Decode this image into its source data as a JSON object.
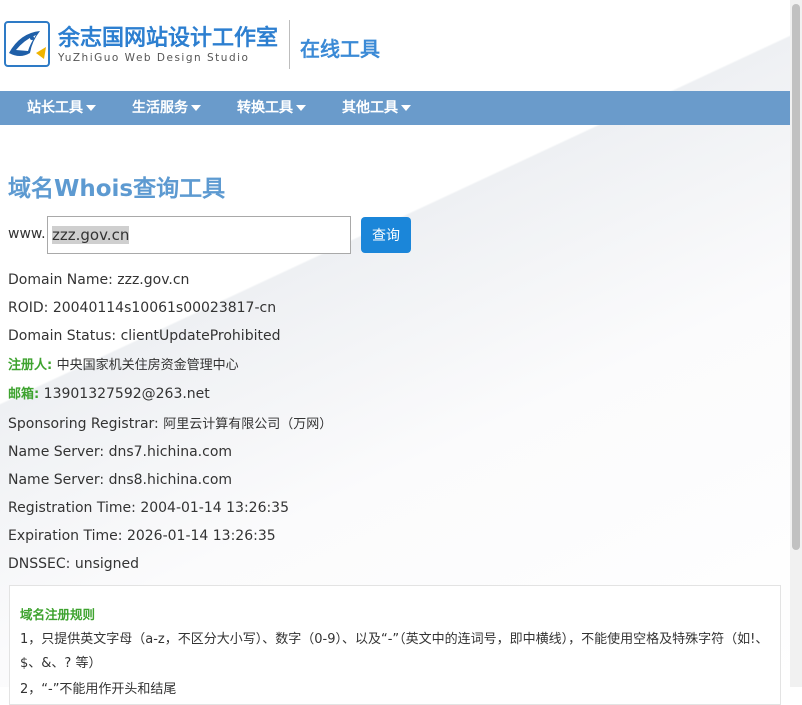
{
  "header": {
    "title": "余志国网站设计工作室",
    "subtitle": "YuZhiGuo Web Design Studio",
    "section": "在线工具"
  },
  "nav": [
    {
      "label": "站长工具"
    },
    {
      "label": "生活服务"
    },
    {
      "label": "转换工具"
    },
    {
      "label": "其他工具"
    }
  ],
  "page": {
    "title": "域名Whois查询工具"
  },
  "search": {
    "prefix": "www.",
    "value": "zzz.gov.cn",
    "button": "查询"
  },
  "results": [
    {
      "label": "Domain Name:",
      "value": "zzz.gov.cn"
    },
    {
      "label": "ROID:",
      "value": "20040114s10061s00023817-cn"
    },
    {
      "label": "Domain Status:",
      "value": "clientUpdateProhibited"
    },
    {
      "label": "注册人:",
      "value": "中央国家机关住房资金管理中心"
    },
    {
      "label": "邮箱:",
      "value": "13901327592@263.net"
    },
    {
      "label": "Sponsoring Registrar:",
      "value": "阿里云计算有限公司（万网）"
    },
    {
      "label": "Name Server:",
      "value": "dns7.hichina.com"
    },
    {
      "label": "Name Server:",
      "value": "dns8.hichina.com"
    },
    {
      "label": "Registration Time:",
      "value": "2004-01-14 13:26:35"
    },
    {
      "label": "Expiration Time:",
      "value": "2026-01-14 13:26:35"
    },
    {
      "label": "DNSSEC:",
      "value": "unsigned"
    }
  ],
  "rules": {
    "title": "域名注册规则",
    "item1": "1，只提供英文字母（a-z，不区分大小写）、数字（0-9）、以及“-”（英文中的连词号，即中横线），不能使用空格及特殊字符（如!、$、&、? 等）",
    "item2": "2，“-”不能用作开头和结尾"
  },
  "colors": {
    "brand": "#2d7fd0",
    "nav_bg": "#6a9bcb",
    "title": "#5d9ad1",
    "button": "#1b86d9",
    "highlight": "#3ea32f"
  }
}
